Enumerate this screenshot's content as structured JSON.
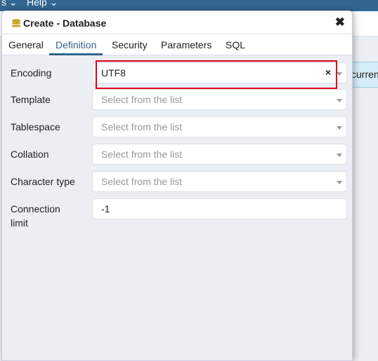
{
  "topbar": {
    "menu_partial": "s",
    "help": "Help"
  },
  "background": {
    "info_text": "curren"
  },
  "dialog": {
    "title": "Create - Database",
    "tabs": [
      {
        "label": "General"
      },
      {
        "label": "Definition",
        "active": true
      },
      {
        "label": "Security"
      },
      {
        "label": "Parameters"
      },
      {
        "label": "SQL"
      }
    ],
    "fields": [
      {
        "label": "Encoding",
        "value": "UTF8",
        "clearable": true
      },
      {
        "label": "Template",
        "placeholder": "Select from the list"
      },
      {
        "label": "Tablespace",
        "placeholder": "Select from the list"
      },
      {
        "label": "Collation",
        "placeholder": "Select from the list"
      },
      {
        "label": "Character type",
        "placeholder": "Select from the list"
      },
      {
        "label": "Connection limit",
        "value": "-1"
      }
    ]
  },
  "colors": {
    "accent": "#326690",
    "highlight": "#e00016"
  }
}
